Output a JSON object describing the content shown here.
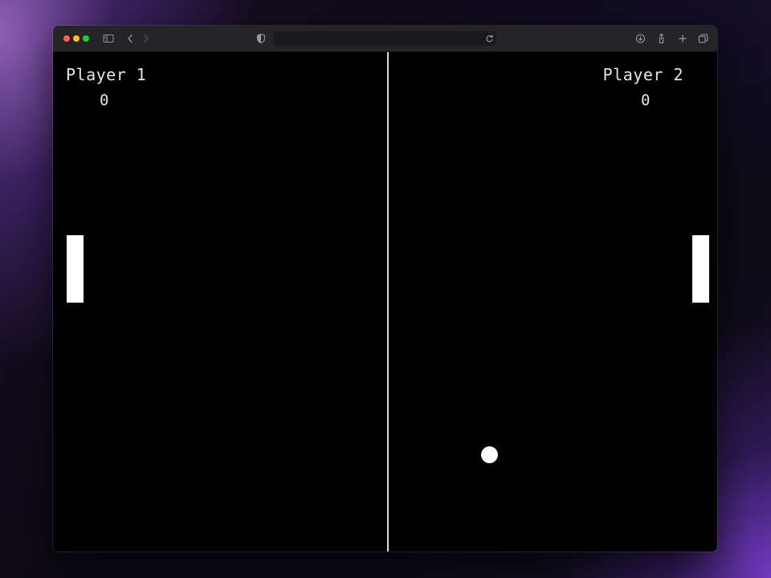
{
  "browser": {
    "url": "",
    "icons": {
      "sidebar": "sidebar-icon",
      "back": "chevron-left-icon",
      "forward": "chevron-right-icon",
      "shield": "shield-icon",
      "reload": "reload-icon",
      "download": "download-icon",
      "share": "share-icon",
      "new_tab": "plus-icon",
      "tabs": "tabs-overview-icon"
    }
  },
  "game": {
    "player1": {
      "name": "Player 1",
      "score": "0"
    },
    "player2": {
      "name": "Player 2",
      "score": "0"
    },
    "colors": {
      "background": "#000000",
      "paddle": "#ffffff",
      "ball": "#ffffff",
      "net": "#d9d9d9",
      "text": "#e6e6e6"
    }
  }
}
